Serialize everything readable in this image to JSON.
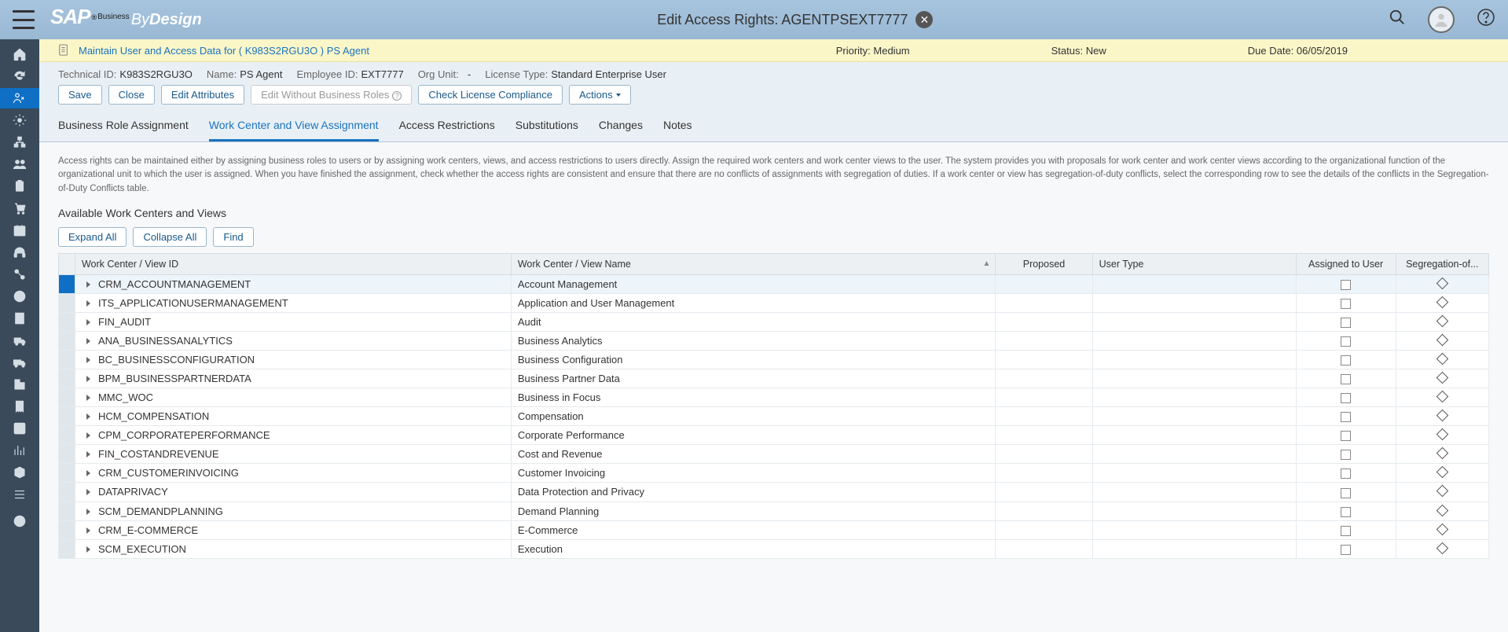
{
  "header": {
    "page_title": "Edit Access Rights: AGENTPSEXT7777"
  },
  "notif": {
    "link_text": "Maintain User and Access Data for ( K983S2RGU3O ) PS Agent",
    "priority_label": "Priority:",
    "priority_value": "Medium",
    "status_label": "Status:",
    "status_value": "New",
    "due_label": "Due Date:",
    "due_value": "06/05/2019"
  },
  "info": {
    "tech_id_label": "Technical ID:",
    "tech_id_value": "K983S2RGU3O",
    "name_label": "Name:",
    "name_value": "PS Agent",
    "emp_id_label": "Employee ID:",
    "emp_id_value": "EXT7777",
    "org_label": "Org Unit:",
    "org_value": "-",
    "license_label": "License Type:",
    "license_value": "Standard Enterprise User"
  },
  "buttons": {
    "save": "Save",
    "close": "Close",
    "edit_attrs": "Edit Attributes",
    "edit_wo_roles": "Edit Without Business Roles",
    "check_license": "Check License Compliance",
    "actions": "Actions"
  },
  "tabs": {
    "biz_role": "Business Role Assignment",
    "wc_view": "Work Center and View Assignment",
    "access_restr": "Access Restrictions",
    "substitutions": "Substitutions",
    "changes": "Changes",
    "notes": "Notes"
  },
  "help_text": "Access rights can be maintained either by assigning business roles to users or by assigning work centers, views, and access restrictions to users directly. Assign the required work centers and work center views to the user. The system provides you with proposals for work center and work center views according to the organizational function of the organizational unit to which the user is assigned. When you have finished the assignment, check whether the access rights are consistent and ensure that there are no conflicts of assignments with segregation of duties. If a work center or view has segregation-of-duty conflicts, select the corresponding row to see the details of the conflicts in the Segregation-of-Duty Conflicts table.",
  "section_title": "Available Work Centers and Views",
  "small_buttons": {
    "expand": "Expand All",
    "collapse": "Collapse All",
    "find": "Find"
  },
  "columns": {
    "id": "Work Center / View ID",
    "name": "Work Center / View Name",
    "proposed": "Proposed",
    "usertype": "User Type",
    "assigned": "Assigned to User",
    "seg": "Segregation-of..."
  },
  "rows": [
    {
      "id": "CRM_ACCOUNTMANAGEMENT",
      "name": "Account Management"
    },
    {
      "id": "ITS_APPLICATIONUSERMANAGEMENT",
      "name": "Application and User Management"
    },
    {
      "id": "FIN_AUDIT",
      "name": "Audit"
    },
    {
      "id": "ANA_BUSINESSANALYTICS",
      "name": "Business Analytics"
    },
    {
      "id": "BC_BUSINESSCONFIGURATION",
      "name": "Business Configuration"
    },
    {
      "id": "BPM_BUSINESSPARTNERDATA",
      "name": "Business Partner Data"
    },
    {
      "id": "MMC_WOC",
      "name": "Business in Focus"
    },
    {
      "id": "HCM_COMPENSATION",
      "name": "Compensation"
    },
    {
      "id": "CPM_CORPORATEPERFORMANCE",
      "name": "Corporate Performance"
    },
    {
      "id": "FIN_COSTANDREVENUE",
      "name": "Cost and Revenue"
    },
    {
      "id": "CRM_CUSTOMERINVOICING",
      "name": "Customer Invoicing"
    },
    {
      "id": "DATAPRIVACY",
      "name": "Data Protection and Privacy"
    },
    {
      "id": "SCM_DEMANDPLANNING",
      "name": "Demand Planning"
    },
    {
      "id": "CRM_E-COMMERCE",
      "name": "E-Commerce"
    },
    {
      "id": "SCM_EXECUTION",
      "name": "Execution"
    }
  ]
}
